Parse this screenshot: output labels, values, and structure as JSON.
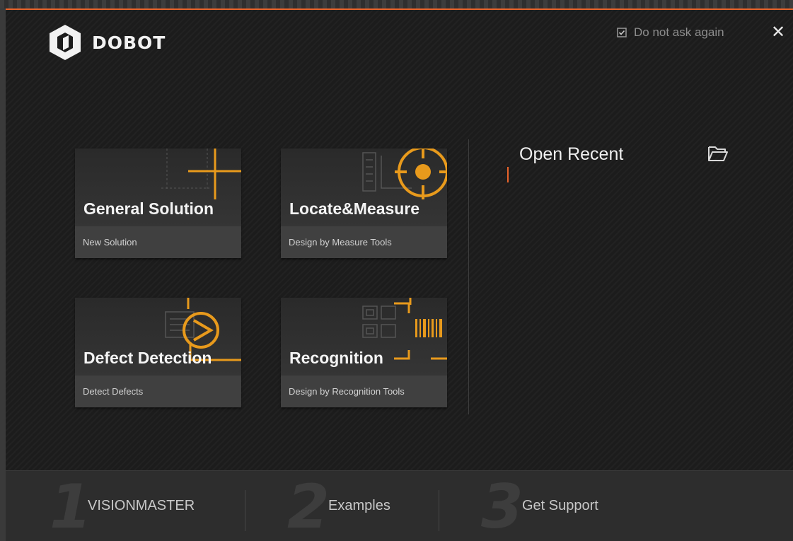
{
  "brand": {
    "name": "DOBOT"
  },
  "header": {
    "dont_ask_label": "Do not ask again",
    "close_label": "✕"
  },
  "cards": [
    {
      "title": "General Solution",
      "subtitle": "New Solution",
      "icon": "crosshair-icon"
    },
    {
      "title": "Locate&Measure",
      "subtitle": "Design by Measure Tools",
      "icon": "target-icon"
    },
    {
      "title": "Defect Detection",
      "subtitle": "Detect Defects",
      "icon": "defect-icon"
    },
    {
      "title": "Recognition",
      "subtitle": "Design by Recognition Tools",
      "icon": "barcode-icon"
    }
  ],
  "recent": {
    "title": "Open Recent",
    "icon": "folder-open-icon"
  },
  "footer": {
    "steps": [
      {
        "num": "1",
        "label": "VISIONMASTER"
      },
      {
        "num": "2",
        "label": "Examples"
      },
      {
        "num": "3",
        "label": "Get Support"
      }
    ]
  },
  "colors": {
    "accent": "#e8632a",
    "icon_orange": "#e89a1c",
    "background": "#1c1c1c",
    "card": "#3f3f3f"
  }
}
